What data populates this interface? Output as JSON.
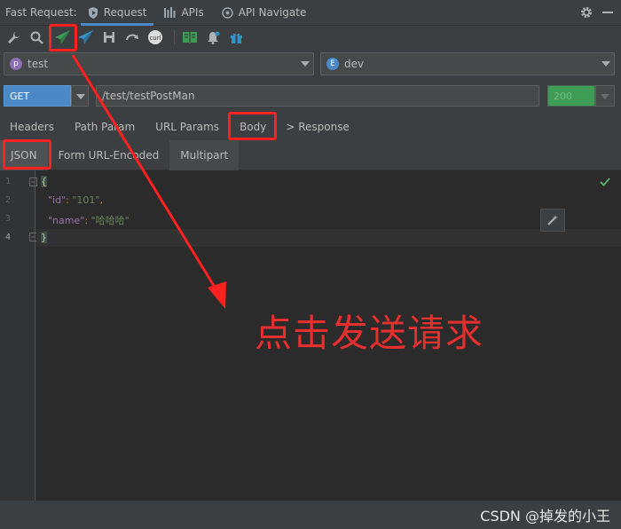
{
  "app_title": "Fast Request:",
  "top_tabs": [
    {
      "label": "Request",
      "icon": "shield-play-icon",
      "active": true
    },
    {
      "label": "APIs",
      "icon": "bar-list-icon",
      "active": false
    },
    {
      "label": "API Navigate",
      "icon": "target-icon",
      "active": false
    }
  ],
  "toolbar": {
    "curl_label": "curl"
  },
  "project": {
    "badge": "p",
    "value": "test",
    "badge_color": "#8a6fb4"
  },
  "environment": {
    "badge": "E",
    "value": "dev",
    "badge_color": "#4a88c7"
  },
  "request": {
    "method": "GET",
    "url": "/test/testPostMan",
    "status": "200"
  },
  "request_tabs": [
    "Headers",
    "Path Param",
    "URL Params",
    "Body",
    "> Response"
  ],
  "body_tabs": [
    "JSON",
    "Form URL-Encoded",
    "Multipart"
  ],
  "line_numbers": [
    "1",
    "2",
    "3",
    "4"
  ],
  "editor": {
    "line1": "{",
    "id_key": "\"id\"",
    "id_value": "\"101\"",
    "name_key": "\"name\"",
    "name_value": "\"哈哈哈\"",
    "line4": "}"
  },
  "annotation": "点击发送请求",
  "watermark": "CSDN @掉发的小王",
  "colors": {
    "accent": "#4a88c7",
    "highlight": "#ff2020",
    "status_green": "#3f9c57",
    "annotation_red": "#e52e2e"
  }
}
